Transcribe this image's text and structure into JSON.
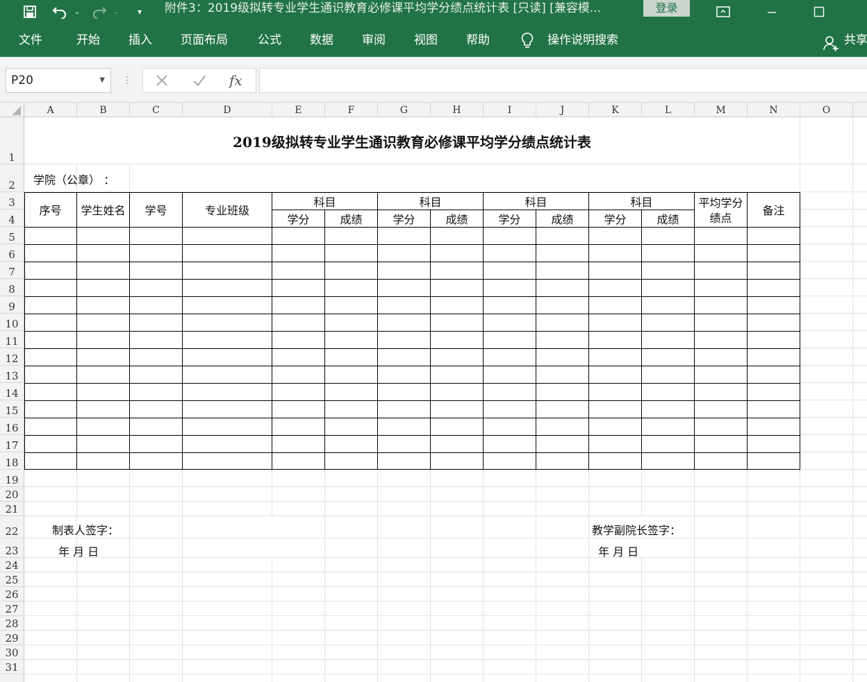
{
  "window": {
    "title": "附件3：2019级拟转专业学生通识教育必修课平均学分绩点统计表  [只读]  [兼容模...",
    "login_label": "登录",
    "share_label": "共享"
  },
  "ribbon": {
    "tabs": [
      "文件",
      "开始",
      "插入",
      "页面布局",
      "公式",
      "数据",
      "审阅",
      "视图",
      "帮助"
    ],
    "tell_me": "操作说明搜索"
  },
  "formula_bar": {
    "name_box": "P20",
    "fx_label": "fx",
    "content": ""
  },
  "columns": [
    "A",
    "B",
    "C",
    "D",
    "E",
    "F",
    "G",
    "H",
    "I",
    "J",
    "K",
    "L",
    "M",
    "N",
    "O"
  ],
  "rows": [
    "1",
    "2",
    "3",
    "4",
    "5",
    "6",
    "7",
    "8",
    "9",
    "10",
    "11",
    "12",
    "13",
    "14",
    "15",
    "16",
    "17",
    "18",
    "19",
    "20",
    "21",
    "22",
    "23",
    "24",
    "25",
    "26",
    "27",
    "28",
    "29",
    "30",
    "31"
  ],
  "sheet": {
    "title": "2019级拟转专业学生通识教育必修课平均学分绩点统计表",
    "college_label": "学院（公章）  ：",
    "headers": {
      "seq": "序号",
      "name": "学生姓名",
      "student_id": "学号",
      "major_class": "专业班级",
      "subject_1": "科目",
      "subject_2": "科目",
      "subject_3": "科目",
      "subject_4": "科目",
      "credit_1": "学分",
      "score_1": "成绩",
      "credit_2": "学分",
      "score_2": "成绩",
      "credit_3": "学分",
      "score_3": "成绩",
      "credit_4": "学分",
      "score_4": "成绩",
      "gpa_line1": "平均学分",
      "gpa_line2": "绩点",
      "remarks": "备注"
    },
    "preparer_sign": "制表人签字：",
    "preparer_date": "年      月        日",
    "dean_sign": "教学副院长签字：",
    "dean_date": "年      月         日"
  }
}
